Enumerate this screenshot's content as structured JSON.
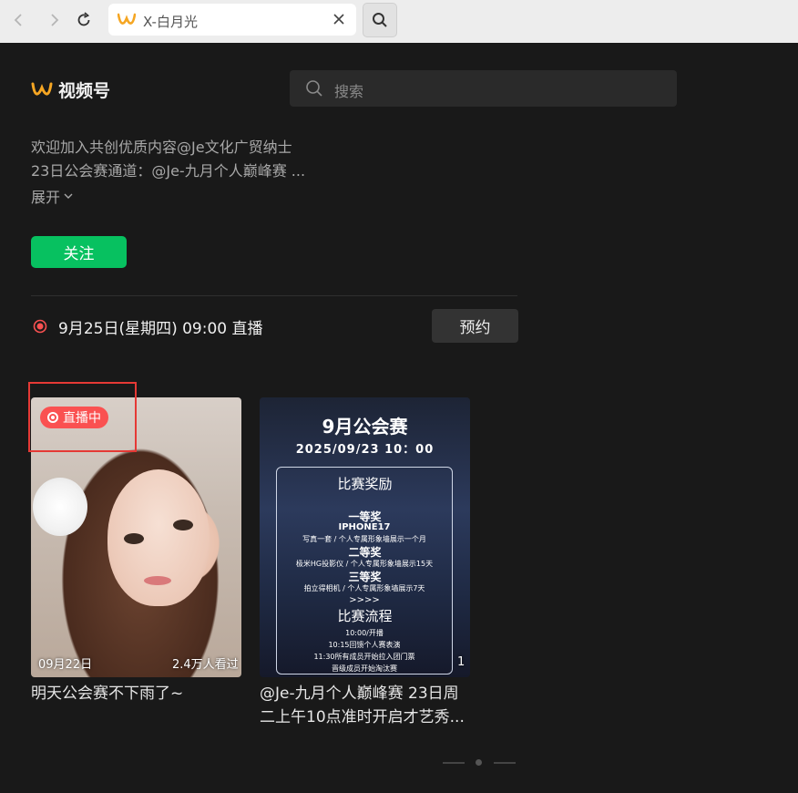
{
  "browser": {
    "tab_title": "X-白月光"
  },
  "header": {
    "brand_name": "视频号",
    "search_placeholder": "搜索"
  },
  "profile": {
    "description_line1": "欢迎加入共创优质内容@Je文化广贸纳士",
    "description_line2": "23日公会赛通道：@Je-九月个人巅峰赛 ...",
    "expand_label": "展开",
    "follow_label": "关注"
  },
  "live_notice": {
    "text": "9月25日(星期四) 09:00 直播",
    "reserve_label": "预约"
  },
  "videos": [
    {
      "badge": "直播中",
      "date": "09月22日",
      "views": "2.4万人看过",
      "title": "明天公会赛不下雨了~"
    },
    {
      "count": "1",
      "title_line1": "@Je-九月个人巅峰赛 23日周",
      "title_line2": "二上午10点准时开启才艺秀...",
      "poster": {
        "heading": "9月公会赛",
        "datetime": "2025/09/23 10：00",
        "section1": "比赛奖励",
        "prize1": "一等奖",
        "prize1_item": "IPHONE17",
        "prize1_desc": "写真一套 / 个人专属形象墙展示一个月",
        "prize2": "二等奖",
        "prize2_desc": "极米HG投影仪 / 个人专属形象墙展示15天",
        "prize3": "三等奖",
        "prize3_desc": "拍立得相机 / 个人专属形象墙展示7天",
        "arrows": ">>>>",
        "section2": "比赛流程",
        "step1": "10:00/开播",
        "step2": "10:15回馈个人赛表演",
        "step3": "11:30所有成员开始拉入团门票",
        "step4": "晋级成员开始淘汰赛"
      }
    }
  ],
  "colors": {
    "accent_green": "#07c160",
    "live_red": "#fa5151",
    "brand_orange": "#f5a623",
    "background": "#191919"
  }
}
